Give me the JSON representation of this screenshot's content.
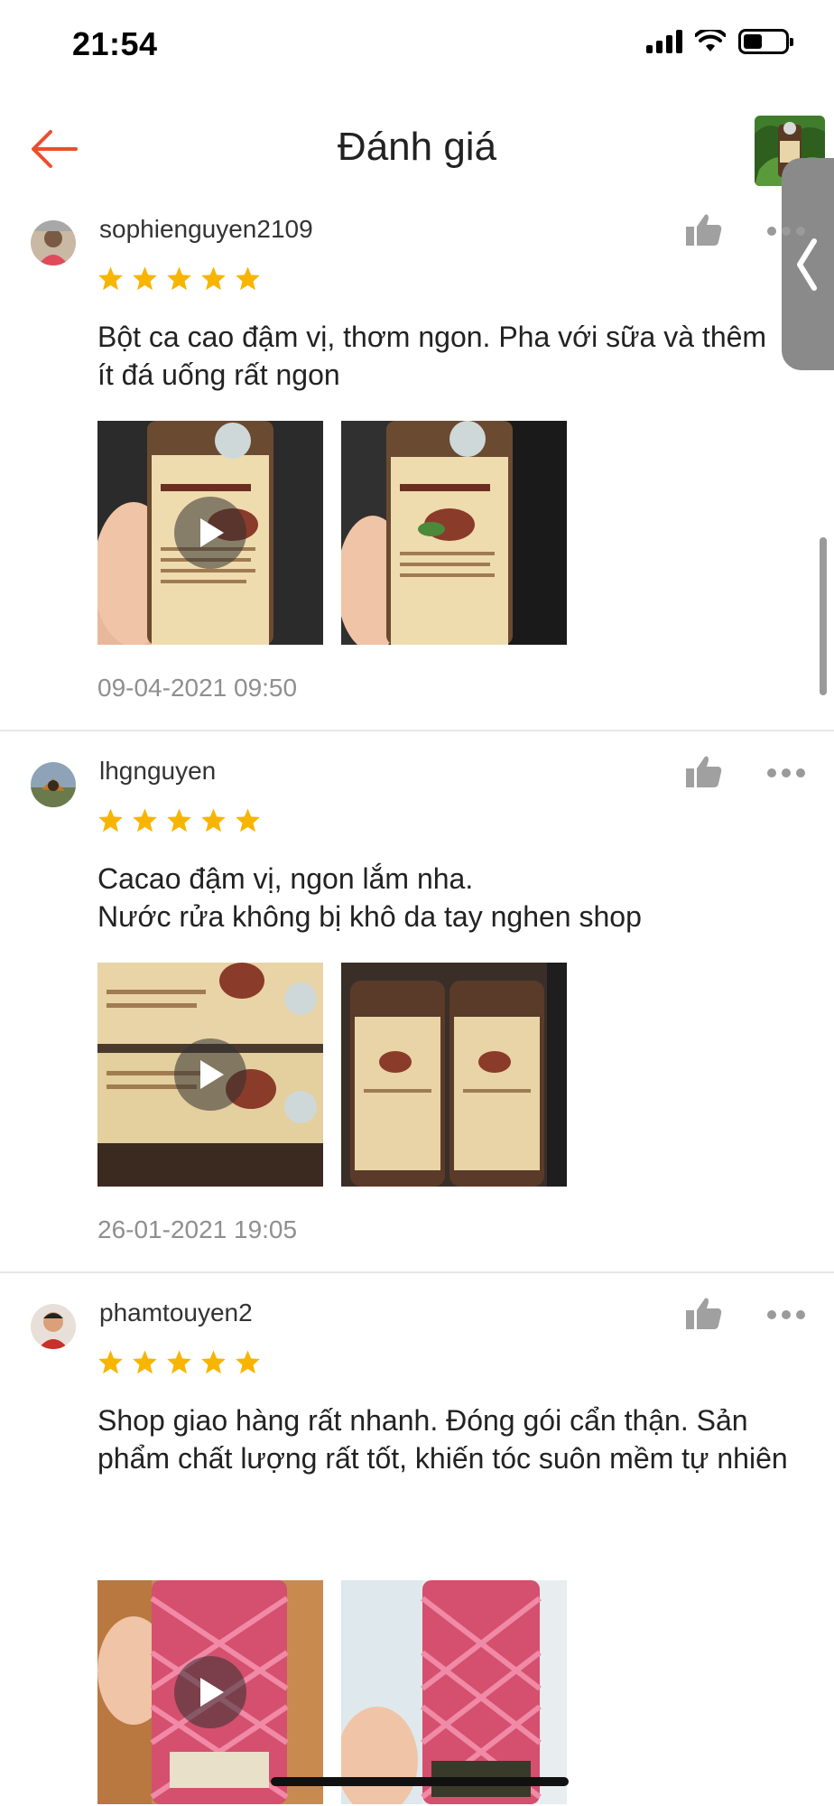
{
  "status_bar": {
    "time": "21:54",
    "battery_level": 0.45
  },
  "header": {
    "title": "Đánh giá"
  },
  "icons": {
    "back": "arrow-left-icon",
    "like": "thumbs-up-icon",
    "more": "more-horizontal-icon",
    "star": "star-icon",
    "play": "play-icon",
    "side_tab": "chevron-left-icon"
  },
  "colors": {
    "star": "#f7b500",
    "back_arrow": "#ee4d2d",
    "date": "#8f8f8f",
    "side_tab": "#8a8a8a"
  },
  "reviews": [
    {
      "username": "sophienguyen2109",
      "rating": 5,
      "text": "Bột ca cao đậm vị, thơm ngon. Pha với sữa và thêm ít đá uống rất ngon",
      "date": "09-04-2021 09:50",
      "media": [
        {
          "type": "video"
        },
        {
          "type": "image"
        }
      ]
    },
    {
      "username": "lhgnguyen",
      "rating": 5,
      "text": "Cacao đậm vị, ngon lắm nha.\nNước rửa không bị khô da tay nghen shop",
      "date": "26-01-2021 19:05",
      "media": [
        {
          "type": "video"
        },
        {
          "type": "image"
        }
      ]
    },
    {
      "username": "phamtouyen2",
      "rating": 5,
      "text": "Shop giao hàng rất nhanh. Đóng gói cẩn thận. Sản phẩm chất lượng rất tốt, khiến tóc suôn mềm tự nhiên",
      "date": "",
      "media": [
        {
          "type": "video"
        },
        {
          "type": "image"
        }
      ]
    }
  ]
}
